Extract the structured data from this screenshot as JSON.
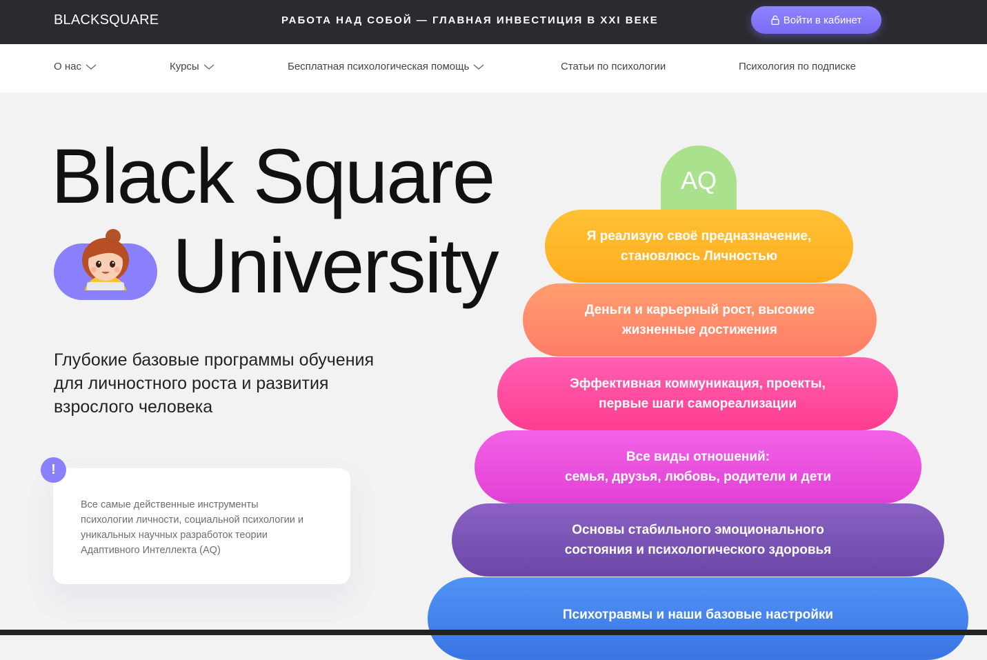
{
  "header": {
    "logo": "BLACKSQUARE",
    "slogan": "РАБОТА НАД СОБОЙ — ГЛАВНАЯ ИНВЕСТИЦИЯ В XXI ВЕКЕ",
    "login_label": "Войти в кабинет",
    "accent_color": "#8a80fb"
  },
  "nav": {
    "items": [
      {
        "label": "О нас",
        "has_dropdown": true
      },
      {
        "label": "Курсы",
        "has_dropdown": true
      },
      {
        "label": "Бесплатная психологическая помощь",
        "has_dropdown": true
      },
      {
        "label": "Статьи по психологии",
        "has_dropdown": false
      },
      {
        "label": "Психология по подписке",
        "has_dropdown": false
      }
    ]
  },
  "hero": {
    "title_line1": "Black Square",
    "title_line2": "University",
    "subtitle_lines": [
      "Глубокие базовые программы обучения",
      "для личностного роста и развития",
      "взрослого человека"
    ],
    "info_lines": [
      "Все самые действенные инструменты",
      "психологии личности, социальной психологии и",
      "уникальных научных разработок теории",
      "Адаптивного Интеллекта (AQ)"
    ]
  },
  "pyramid": {
    "top_label": "AQ",
    "tiers": [
      {
        "lines": [
          "Я реализую своё предназначение,",
          "становлюсь Личностью"
        ],
        "color": "#ffb82a"
      },
      {
        "lines": [
          "Деньги и карьерный рост, высокие",
          "жизненные достижения"
        ],
        "color": "#ff8c6a"
      },
      {
        "lines": [
          "Эффективная коммуникация, проекты,",
          "первые шаги самореализации"
        ],
        "color": "#ff4ea2"
      },
      {
        "lines": [
          "Все виды отношений:",
          "семья, друзья, любовь, родители и дети"
        ],
        "color": "#ea52de"
      },
      {
        "lines": [
          "Основы стабильного эмоционального",
          "состояния и психологического здоровья"
        ],
        "color": "#7b55b6"
      },
      {
        "lines": [
          "Психотравмы и наши базовые настройки"
        ],
        "color": "#4584ec"
      }
    ]
  }
}
